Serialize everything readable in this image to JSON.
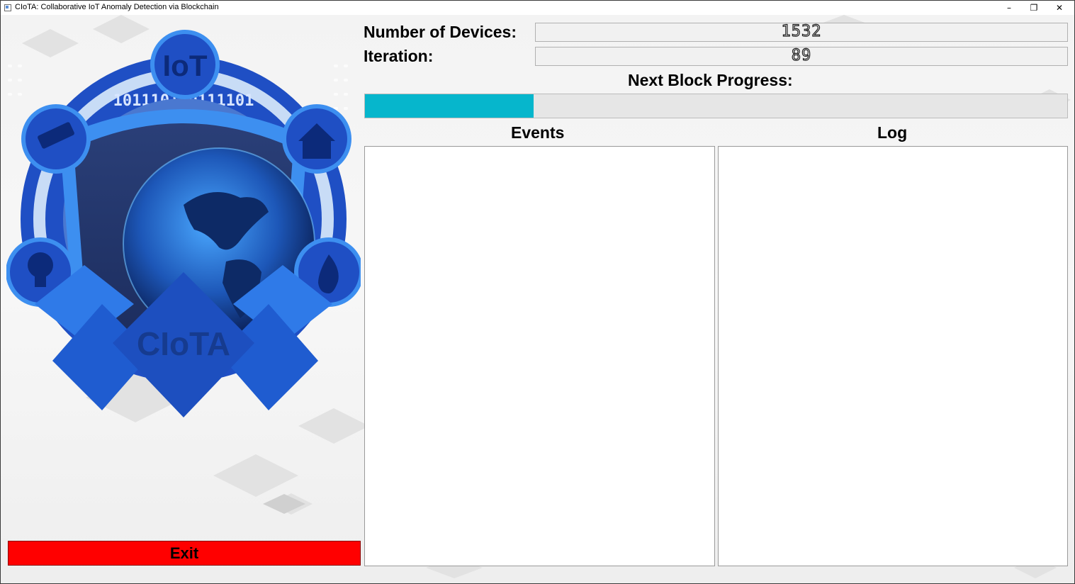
{
  "window": {
    "title": "CIoTA: Collaborative IoT Anomaly Detection via Blockchain",
    "minimize_glyph": "–",
    "restore_glyph": "❐",
    "close_glyph": "✕"
  },
  "logo": {
    "badge_text": "IoT",
    "shield_text": "CIoTA"
  },
  "stats": {
    "devices_label": "Number of Devices:",
    "devices_value": "1532",
    "iteration_label": "Iteration:",
    "iteration_value": "89"
  },
  "progress": {
    "label": "Next Block Progress:",
    "fraction": 0.24
  },
  "panels": {
    "events_title": "Events",
    "log_title": "Log"
  },
  "exit_label": "Exit",
  "colors": {
    "progress_fill": "#06b6cc",
    "exit_button": "#ff0000",
    "logo_blue": "#1e4fc2",
    "logo_light_blue": "#3d8ff0"
  },
  "icons": [
    "camera-icon",
    "home-icon",
    "lightbulb-icon",
    "fire-icon",
    "globe-icon"
  ]
}
